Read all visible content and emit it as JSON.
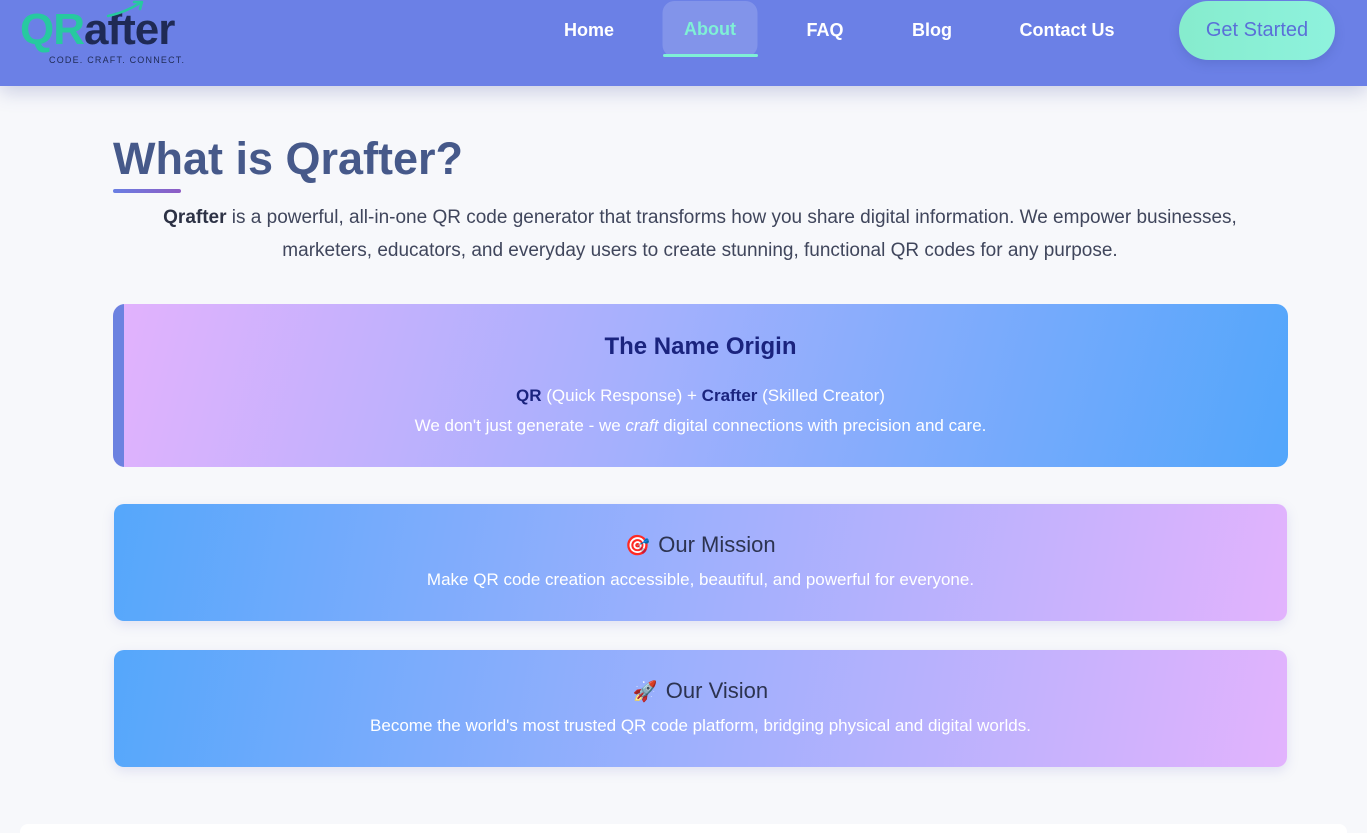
{
  "brand": {
    "logo_qr": "QR",
    "logo_after": "after",
    "tagline": "CODE. CRAFT. CONNECT.",
    "colors": {
      "header": "#6b80e6",
      "accent": "#27c9a0",
      "active_nav": "#7ff0d6"
    }
  },
  "nav": {
    "items": [
      {
        "label": "Home"
      },
      {
        "label": "About",
        "active": true
      },
      {
        "label": "FAQ"
      },
      {
        "label": "Blog"
      },
      {
        "label": "Contact Us"
      }
    ],
    "cta_label": "Get Started"
  },
  "main": {
    "title": "What is Qrafter?",
    "intro_brand": "Qrafter",
    "intro_text": " is a powerful, all-in-one QR code generator that transforms how you share digital information. We empower businesses, marketers, educators, and everyday users to create stunning, functional QR codes for any purpose."
  },
  "origin": {
    "title": "The Name Origin",
    "term1": "QR",
    "term1_desc": " (Quick Response) + ",
    "term2": "Crafter",
    "term2_desc": " (Skilled Creator)",
    "line2_before": "We don't just generate - we ",
    "line2_em": "craft",
    "line2_after": " digital connections with precision and care."
  },
  "mission": {
    "icon": "target-icon",
    "emoji": "🎯",
    "title": "Our Mission",
    "text": "Make QR code creation accessible, beautiful, and powerful for everyone."
  },
  "vision": {
    "icon": "rocket-icon",
    "emoji": "🚀",
    "title": "Our Vision",
    "text": "Become the world's most trusted QR code platform, bridging physical and digital worlds."
  }
}
